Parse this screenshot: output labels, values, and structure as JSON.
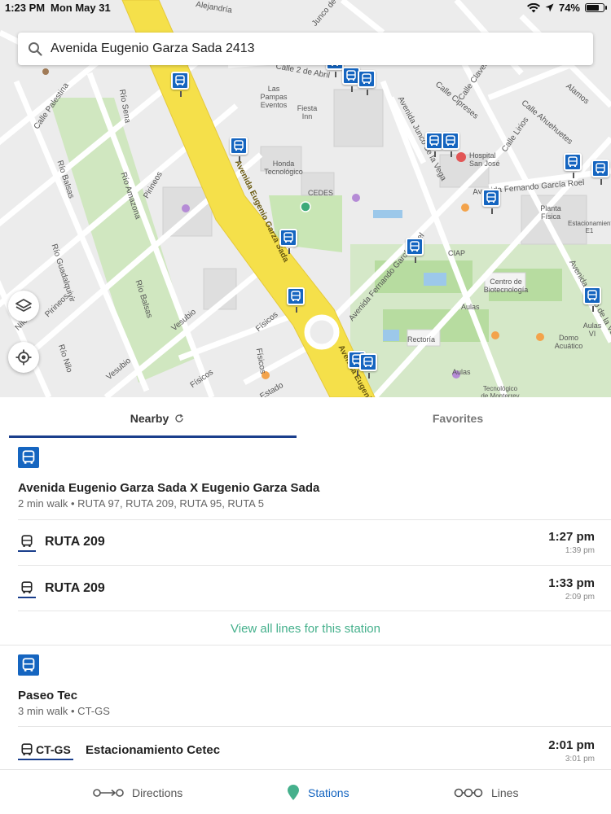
{
  "status_bar": {
    "time": "1:23 PM",
    "date": "Mon May 31",
    "battery": "74%"
  },
  "search": {
    "value": "Avenida Eugenio Garza Sada 2413"
  },
  "map_labels": {
    "calle_2_abril": "Calle 2 de Abril",
    "ave_garza": "Avenida Eugenio Garza Sada",
    "ave_garza2": "Avenida Eugenio",
    "ave_junco": "Avenida Junco de la Vega",
    "ave_junco2": "Avenida Junco de la Vega",
    "ave_fernando": "Avenida Fernando García Roel",
    "ave_fernando2": "Avenida Fernando García Roel",
    "calle_cipreses": "Calle Cipreses",
    "calle_clavel": "Calle Clavel",
    "calle_ahuehuetes": "Calle Ahuehuetes",
    "calle_lirios": "Calle Lirios",
    "alamos": "Alamos",
    "calle_palestina": "Calle Palestina",
    "rio_sena": "Río Sena",
    "rio_balsas": "Río Balsas",
    "rio_amazona": "Río Amazona",
    "pirineos": "Pirineos",
    "rio_guadalquivir": "Río Guadalquivir",
    "pirineos2": "Pirineos",
    "rio_nilo": "Río Nilo",
    "nilo": "Nilo",
    "rio_balsas2": "Río Balsas",
    "vesubio": "Vesubio",
    "vesubio2": "Vesubio",
    "fisicos": "Físicos",
    "fisicos2": "Físicos",
    "fisicos3": "Físicos",
    "estado": "Estado",
    "las_pampas": "Las Pampas Eventos",
    "fiesta_inn": "Fiesta Inn",
    "honda": "Honda Tecnológico",
    "cedes": "CEDES",
    "hospital": "Hospital San José",
    "planta": "Planta Física",
    "estacionamiento": "Estacionamiento E1",
    "ciap": "CIAP",
    "biotec": "Centro de Biotecnología",
    "aulas1": "Aulas",
    "aulas2": "Aulas VI",
    "aulas3": "Aulas",
    "rectoria": "Rectoría",
    "domo": "Domo Acuático",
    "tec_monterrey": "Tecnológico de Monterrey",
    "alejandro": "Alejandría",
    "junco": "Junco de"
  },
  "tabs": {
    "nearby": "Nearby",
    "favorites": "Favorites"
  },
  "stations": [
    {
      "name": "Avenida Eugenio Garza Sada X Eugenio Garza Sada",
      "meta": "2 min walk • RUTA 97, RUTA 209, RUTA 95, RUTA 5",
      "lines": [
        {
          "name": "RUTA 209",
          "time": "1:27 pm",
          "next": "1:39 pm"
        },
        {
          "name": "RUTA 209",
          "time": "1:33 pm",
          "next": "2:09 pm"
        }
      ],
      "view_all": "View all lines for this station"
    },
    {
      "name": "Paseo Tec",
      "meta": "3 min walk • CT-GS",
      "lines": [
        {
          "code": "CT-GS",
          "name": "Estacionamiento Cetec",
          "time": "2:01 pm",
          "next": "3:01 pm"
        }
      ]
    }
  ],
  "bottom_nav": {
    "directions": "Directions",
    "stations": "Stations",
    "lines": "Lines"
  },
  "colors": {
    "accent": "#1565c0",
    "tab_indicator": "#1a3e8c",
    "link": "#45b08c",
    "road_major": "#f5e04a",
    "park": "#c9e6b5"
  },
  "icons": [
    "search-icon",
    "bus-icon",
    "layers-icon",
    "locate-icon",
    "refresh-icon",
    "directions-icon",
    "station-pin-icon",
    "lines-icon",
    "wifi-icon",
    "location-arrow-icon",
    "battery-icon"
  ]
}
